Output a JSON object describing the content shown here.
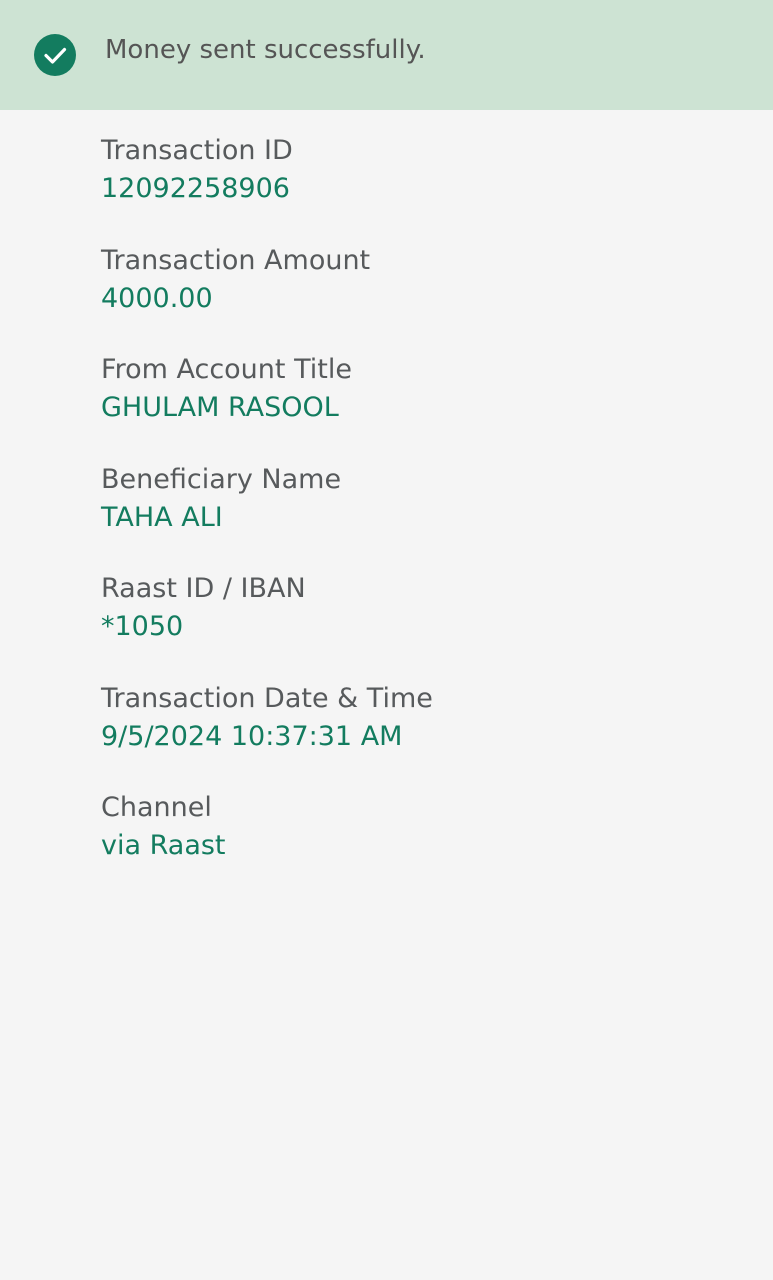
{
  "banner": {
    "icon": "check-circle-icon",
    "icon_color": "#137c5f",
    "background_color": "#cde3d3",
    "message": "Money sent successfully."
  },
  "details": [
    {
      "label": "Transaction ID",
      "value": "12092258906"
    },
    {
      "label": "Transaction Amount",
      "value": "4000.00"
    },
    {
      "label": "From Account Title",
      "value": "GHULAM RASOOL"
    },
    {
      "label": "Beneficiary Name",
      "value": "TAHA ALI"
    },
    {
      "label": "Raast ID / IBAN",
      "value": "*1050"
    },
    {
      "label": "Transaction Date & Time",
      "value": "9/5/2024 10:37:31 AM"
    },
    {
      "label": "Channel",
      "value": "via Raast"
    }
  ],
  "colors": {
    "label_text": "#575a5c",
    "value_text": "#137c5f",
    "page_background": "#f5f5f5"
  }
}
